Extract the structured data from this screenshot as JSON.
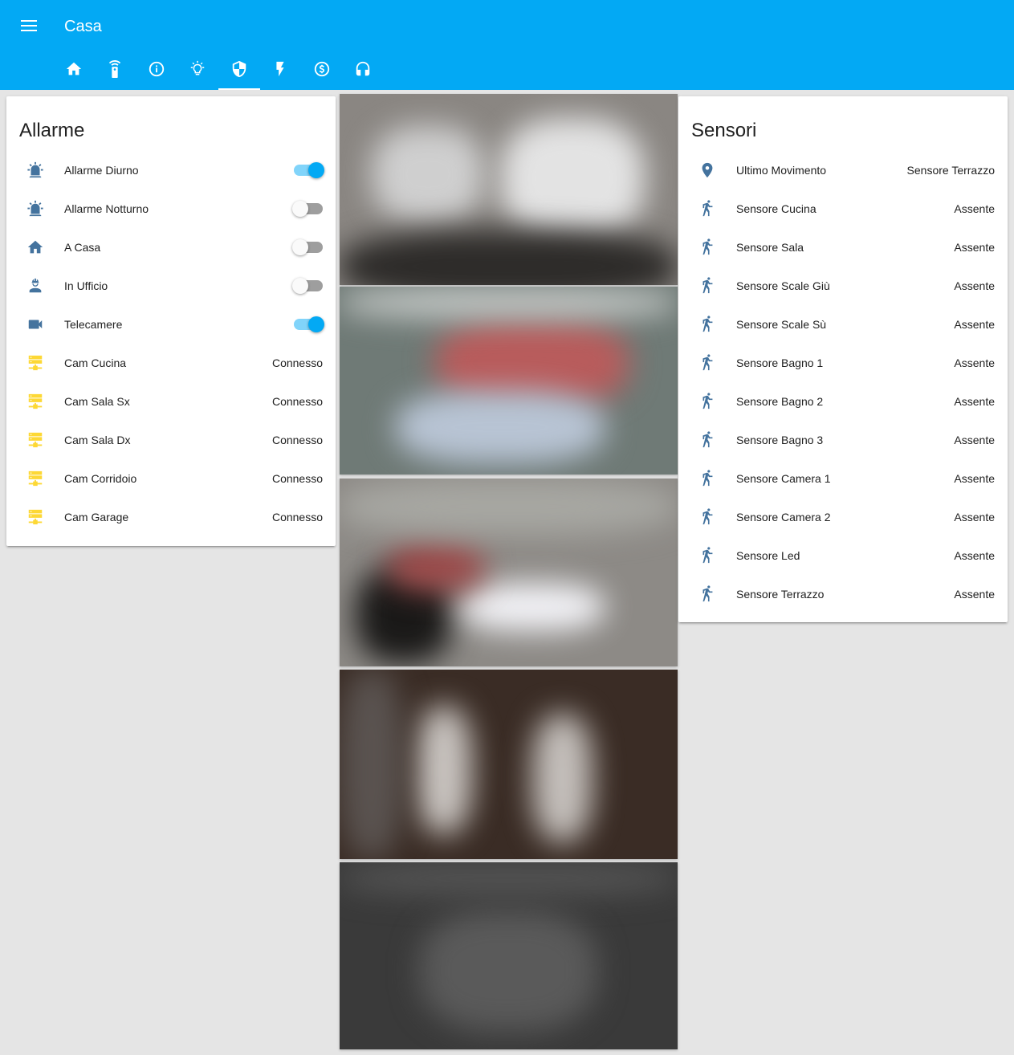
{
  "header": {
    "title": "Casa",
    "tabs": [
      {
        "icon": "home-icon",
        "active": false
      },
      {
        "icon": "remote-icon",
        "active": false
      },
      {
        "icon": "info-icon",
        "active": false
      },
      {
        "icon": "lightbulb-icon",
        "active": false
      },
      {
        "icon": "security-shield-icon",
        "active": true
      },
      {
        "icon": "flash-icon",
        "active": false
      },
      {
        "icon": "currency-icon",
        "active": false
      },
      {
        "icon": "headphones-icon",
        "active": false
      }
    ]
  },
  "colors": {
    "header_bg": "#03a9f4",
    "entity_icon": "#44739e",
    "camera_icon": "#fdd835",
    "toggle_on": "#03a9f4",
    "background": "#e5e5e5"
  },
  "allarme_card": {
    "title": "Allarme",
    "rows": [
      {
        "icon": "alarm-light-icon",
        "label": "Allarme Diurno",
        "type": "toggle",
        "on": true
      },
      {
        "icon": "alarm-light-icon",
        "label": "Allarme Notturno",
        "type": "toggle",
        "on": false
      },
      {
        "icon": "home-icon",
        "label": "A Casa",
        "type": "toggle",
        "on": false
      },
      {
        "icon": "worker-icon",
        "label": "In Ufficio",
        "type": "toggle",
        "on": false
      },
      {
        "icon": "video-camera-icon",
        "label": "Telecamere",
        "type": "toggle",
        "on": true
      },
      {
        "icon": "server-network-icon",
        "label": "Cam Cucina",
        "type": "state",
        "state": "Connesso"
      },
      {
        "icon": "server-network-icon",
        "label": "Cam Sala Sx",
        "type": "state",
        "state": "Connesso"
      },
      {
        "icon": "server-network-icon",
        "label": "Cam Sala Dx",
        "type": "state",
        "state": "Connesso"
      },
      {
        "icon": "server-network-icon",
        "label": "Cam Corridoio",
        "type": "state",
        "state": "Connesso"
      },
      {
        "icon": "server-network-icon",
        "label": "Cam Garage",
        "type": "state",
        "state": "Connesso"
      }
    ]
  },
  "sensori_card": {
    "title": "Sensori",
    "rows": [
      {
        "icon": "map-marker-icon",
        "label": "Ultimo Movimento",
        "state": "Sensore Terrazzo"
      },
      {
        "icon": "walk-icon",
        "label": "Sensore Cucina",
        "state": "Assente"
      },
      {
        "icon": "walk-icon",
        "label": "Sensore Sala",
        "state": "Assente"
      },
      {
        "icon": "walk-icon",
        "label": "Sensore Scale Giù",
        "state": "Assente"
      },
      {
        "icon": "walk-icon",
        "label": "Sensore Scale Sù",
        "state": "Assente"
      },
      {
        "icon": "walk-icon",
        "label": "Sensore Bagno 1",
        "state": "Assente"
      },
      {
        "icon": "walk-icon",
        "label": "Sensore Bagno 2",
        "state": "Assente"
      },
      {
        "icon": "walk-icon",
        "label": "Sensore Bagno 3",
        "state": "Assente"
      },
      {
        "icon": "walk-icon",
        "label": "Sensore Camera 1",
        "state": "Assente"
      },
      {
        "icon": "walk-icon",
        "label": "Sensore Camera 2",
        "state": "Assente"
      },
      {
        "icon": "walk-icon",
        "label": "Sensore Led",
        "state": "Assente"
      },
      {
        "icon": "walk-icon",
        "label": "Sensore Terrazzo",
        "state": "Assente"
      }
    ]
  }
}
